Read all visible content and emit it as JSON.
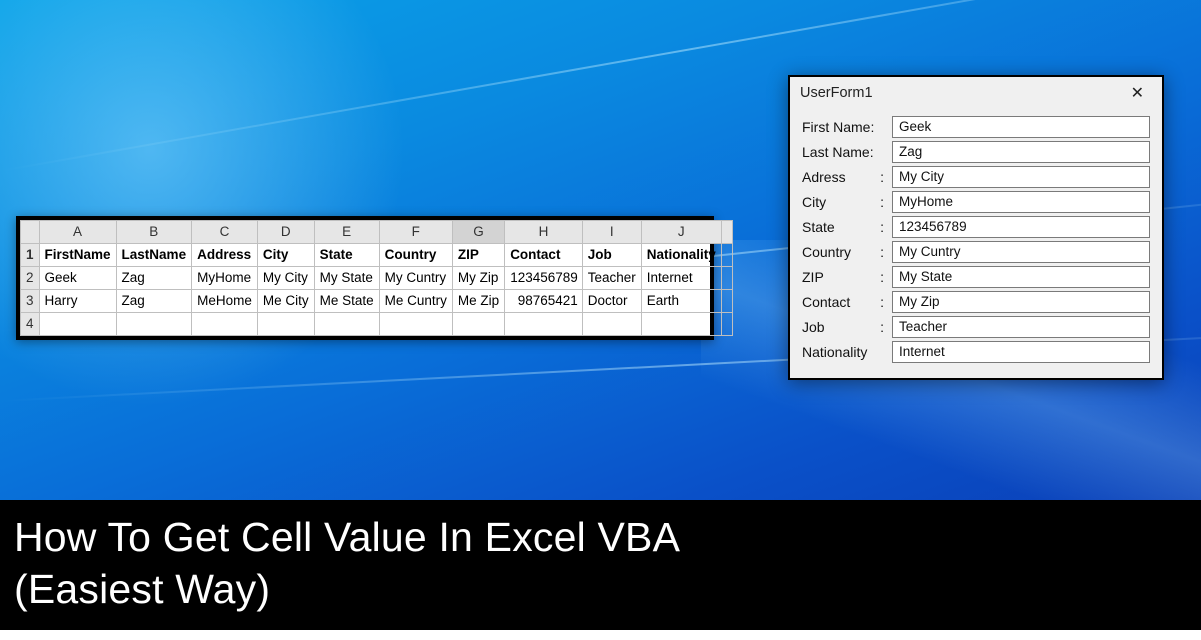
{
  "headline": {
    "line1": "How To Get Cell Value In Excel VBA",
    "line2": "(Easiest Way)"
  },
  "excel": {
    "columns": [
      "A",
      "B",
      "C",
      "D",
      "E",
      "F",
      "G",
      "H",
      "I",
      "J"
    ],
    "headerRow": {
      "n": "1",
      "cells": [
        "FirstName",
        "LastName",
        "Address",
        "City",
        "State",
        "Country",
        "ZIP",
        "Contact",
        "Job",
        "Nationality"
      ]
    },
    "rows": [
      {
        "n": "2",
        "cells": [
          "Geek",
          "Zag",
          "MyHome",
          "My City",
          "My State",
          "My Cuntry",
          "My Zip",
          "123456789",
          "Teacher",
          "Internet"
        ]
      },
      {
        "n": "3",
        "cells": [
          "Harry",
          "Zag",
          "MeHome",
          "Me City",
          "Me State",
          "Me Cuntry",
          "Me Zip",
          "98765421",
          "Doctor",
          "Earth"
        ]
      }
    ],
    "blankRow": "4",
    "selectedCol": "G"
  },
  "userform": {
    "title": "UserForm1",
    "fields": [
      {
        "label": "First Name:",
        "colon": false,
        "value": "Geek"
      },
      {
        "label": "Last Name:",
        "colon": false,
        "value": "Zag"
      },
      {
        "label": "Adress",
        "colon": true,
        "value": "My City"
      },
      {
        "label": "City",
        "colon": true,
        "value": "MyHome"
      },
      {
        "label": "State",
        "colon": true,
        "value": "123456789"
      },
      {
        "label": "Country",
        "colon": true,
        "value": "My Cuntry"
      },
      {
        "label": "ZIP",
        "colon": true,
        "value": "My State"
      },
      {
        "label": "Contact",
        "colon": true,
        "value": "My Zip"
      },
      {
        "label": "Job",
        "colon": true,
        "value": "Teacher"
      },
      {
        "label": "Nationality",
        "colon": false,
        "value": "Internet"
      }
    ]
  }
}
